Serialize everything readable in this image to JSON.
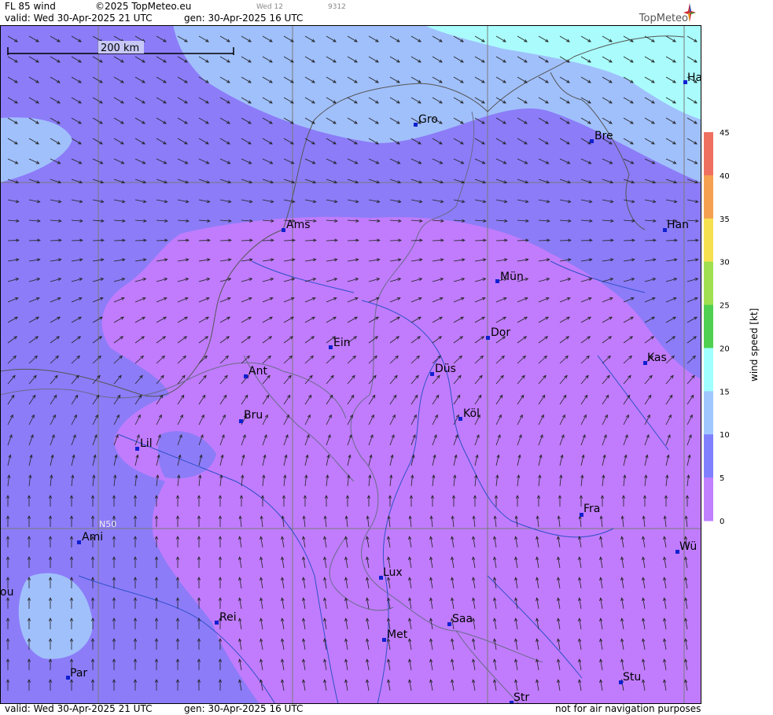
{
  "header": {
    "product": "FL 85 wind",
    "copyright": "©2025 TopMeteo.eu",
    "valid": "valid:  Wed  30-Apr-2025  21 UTC",
    "gen": "gen: 30-Apr-2025 16 UTC",
    "day_small": "Wed 12",
    "code_small": "9312",
    "logo": "TopMeteo"
  },
  "footer": {
    "valid": "valid:  Wed  30-Apr-2025  21 UTC",
    "gen": "gen: 30-Apr-2025 16 UTC",
    "disclaimer": "not for air navigation purposes"
  },
  "map": {
    "scale_label": "200 km",
    "lat_label": "N50",
    "cities": [
      "Gro",
      "Ha",
      "Bre",
      "Ams",
      "Han",
      "Mün",
      "Dor",
      "Ein",
      "Kas",
      "Ant",
      "Düs",
      "Köl",
      "Bru",
      "Lil",
      "Fra",
      "Ami",
      "Wü",
      "Lux",
      "ou",
      "Rei",
      "Saa",
      "Met",
      "Par",
      "Stu",
      "Str"
    ]
  },
  "legend": {
    "title": "wind speed [kt]",
    "ticks": [
      "45",
      "40",
      "35",
      "30",
      "25",
      "20",
      "15",
      "10",
      "5",
      "0"
    ],
    "colors": [
      "#f07060",
      "#f5a050",
      "#f5e050",
      "#a0e050",
      "#50d050",
      "#a0ffff",
      "#a0c8ff",
      "#8080ff",
      "#c080ff"
    ]
  }
}
